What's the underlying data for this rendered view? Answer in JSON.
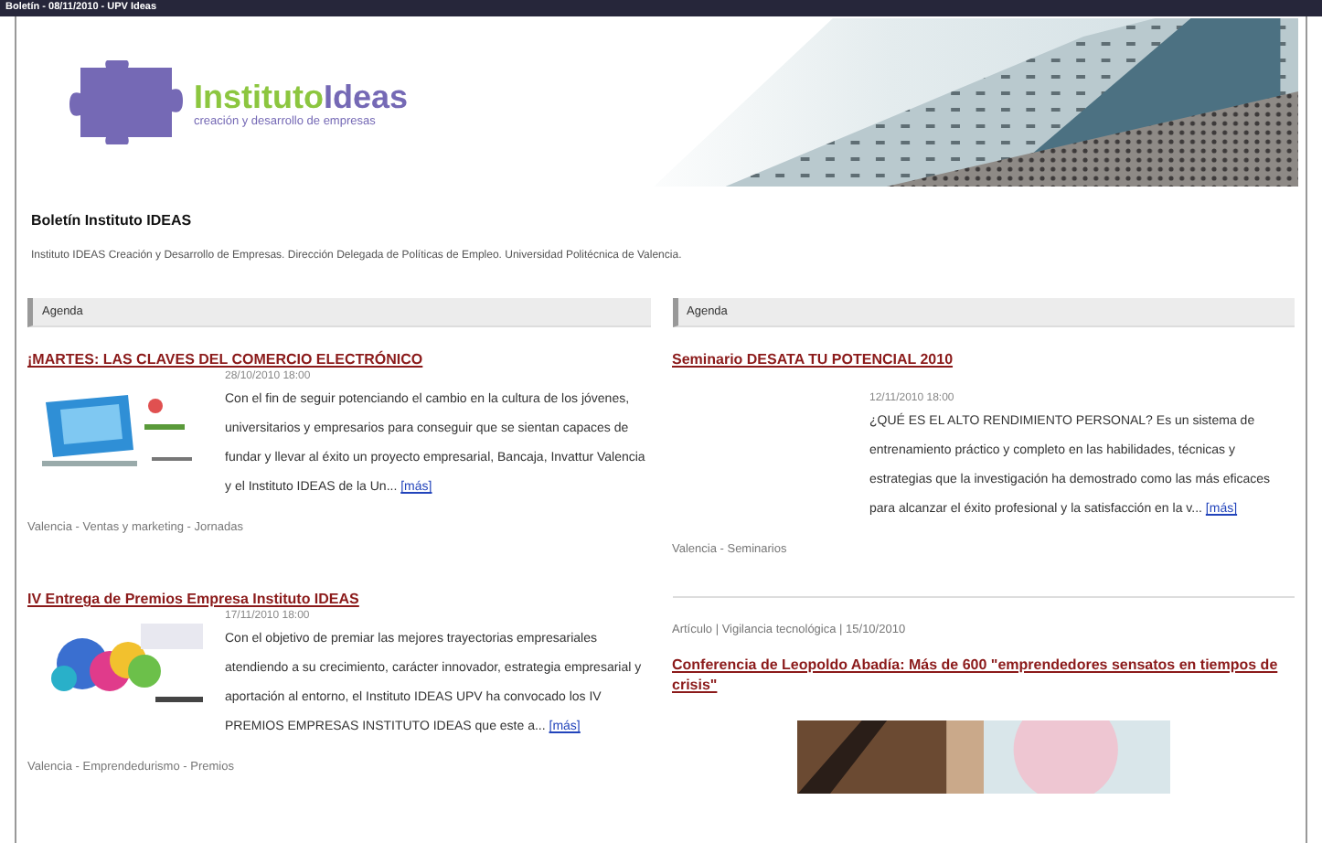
{
  "window": {
    "title": "Boletín - 08/11/2010 - UPV Ideas"
  },
  "banner": {
    "logo_name": "Instituto",
    "logo_accent": "Ideas",
    "tagline": "creación y desarrollo de empresas"
  },
  "bulletin": {
    "title": "Boletín Instituto IDEAS",
    "subtitle": "Instituto IDEAS Creación y Desarrollo de Empresas. Dirección Delegada de Políticas de Empleo. Universidad Politécnica de Valencia."
  },
  "columns": [
    {
      "heading": "Agenda",
      "items": [
        {
          "kind": "event",
          "title": "¡MARTES: LAS CLAVES DEL COMERCIO ELECTRÓNICO",
          "date": "28/10/2010 18:00",
          "body": "Con el fin de seguir potenciando el cambio en la cultura de los jóvenes, universitarios y empresarios para conseguir que se sientan capaces de fundar y llevar al éxito un proyecto empresarial, Bancaja, Invattur Valencia y el Instituto IDEAS de la Un...",
          "more": "[más]",
          "tags": "Valencia - Ventas y marketing - Jornadas"
        },
        {
          "kind": "event",
          "title": "IV Entrega de Premios Empresa Instituto IDEAS",
          "date": "17/11/2010 18:00",
          "body": "Con el objetivo de premiar las mejores trayectorias empresariales atendiendo a su crecimiento, carácter innovador, estrategia empresarial y aportación al entorno, el Instituto IDEAS UPV ha convocado los IV PREMIOS EMPRESAS INSTITUTO IDEAS que este a...",
          "more": "[más]",
          "tags": "Valencia - Emprendedurismo - Premios"
        }
      ]
    },
    {
      "heading": "Agenda",
      "items": [
        {
          "kind": "event",
          "title": "Seminario DESATA TU POTENCIAL 2010",
          "date": "12/11/2010 18:00",
          "body": "¿QUÉ ES EL ALTO RENDIMIENTO PERSONAL? Es un sistema de entrenamiento práctico y completo en las habilidades, técnicas y estrategias que la investigación ha demostrado como las más eficaces para alcanzar el éxito profesional y la satisfacción en la v...",
          "more": "[más]",
          "tags": "Valencia - Seminarios"
        },
        {
          "kind": "article",
          "meta": "Artículo | Vigilancia tecnológica | 15/10/2010",
          "title": "Conferencia de Leopoldo Abadía: Más de 600 \"emprendedores sensatos en tiempos de crisis\""
        }
      ]
    }
  ]
}
